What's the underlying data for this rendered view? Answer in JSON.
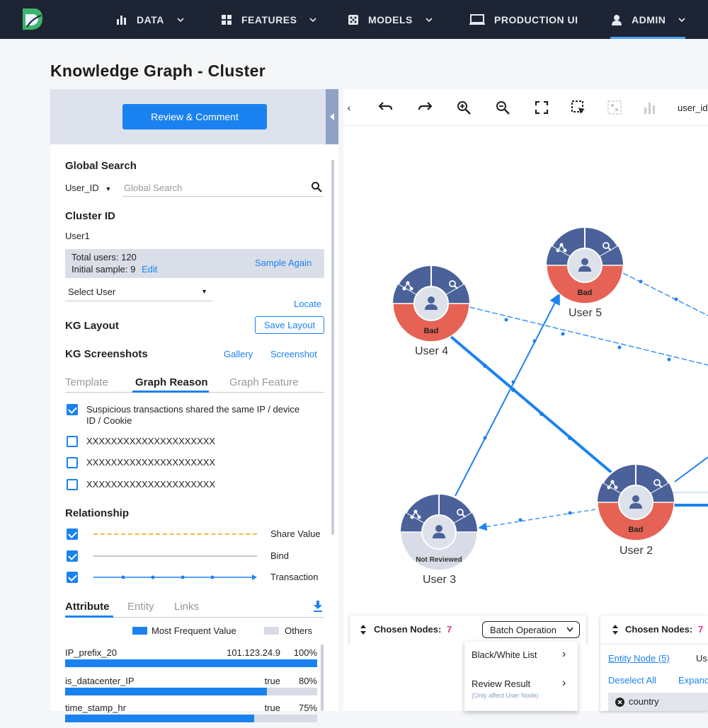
{
  "nav": {
    "items": [
      {
        "label": "DATA",
        "icon": "bar-chart-icon"
      },
      {
        "label": "FEATURES",
        "icon": "grid-icon"
      },
      {
        "label": "MODELS",
        "icon": "dice-icon"
      },
      {
        "label": "PRODUCTION UI",
        "icon": "monitor-icon"
      },
      {
        "label": "ADMIN",
        "icon": "user-icon"
      }
    ],
    "active": "ADMIN"
  },
  "page_title": "Knowledge Graph - Cluster",
  "left": {
    "review_button": "Review & Comment",
    "global_search": {
      "title": "Global Search",
      "field": "User_ID",
      "placeholder": "Global Search"
    },
    "cluster": {
      "title": "Cluster ID",
      "value": "User1",
      "total_users": "Total users: 120",
      "initial_sample": "Initial sample: 9",
      "edit": "Edit",
      "sample_again": "Sample Again"
    },
    "select_user": "Select User",
    "locate": "Locate",
    "kg_layout": "KG Layout",
    "save_layout": "Save Layout",
    "kg_screenshots": "KG Screenshots",
    "gallery": "Gallery",
    "screenshot": "Screenshot",
    "tabs": [
      "Template",
      "Graph Reason",
      "Graph Feature"
    ],
    "active_tab": "Graph Reason",
    "reasons": [
      {
        "text": "Suspicious transactions shared the same IP / device",
        "text2": "ID / Cookie",
        "checked": true
      },
      {
        "text": "XXXXXXXXXXXXXXXXXXXXX",
        "checked": false
      },
      {
        "text": "XXXXXXXXXXXXXXXXXXXXX",
        "checked": false
      },
      {
        "text": "XXXXXXXXXXXXXXXXXXXXX",
        "checked": false
      }
    ],
    "relationship_title": "Relationship",
    "relationships": [
      {
        "label": "Share Value",
        "style": "dashed",
        "color": "#f3b94a"
      },
      {
        "label": "Bind",
        "style": "solid",
        "color": "#c4c7cc"
      },
      {
        "label": "Transaction",
        "style": "arrow",
        "color": "#1a82f0"
      }
    ],
    "attr_tabs": [
      "Attribute",
      "Entity",
      "Links"
    ],
    "legend": {
      "most": "Most Frequent Value",
      "others": "Others",
      "most_color": "#1a82f0",
      "others_color": "#d6dbe6"
    },
    "attributes": [
      {
        "name": "IP_prefix_20",
        "value": "101.123.24.9",
        "pct": "100%",
        "frac": 1.0
      },
      {
        "name": "is_datacenter_IP",
        "value": "true",
        "pct": "80%",
        "frac": 0.8
      },
      {
        "name": "time_stamp_hr",
        "value": "true",
        "pct": "75%",
        "frac": 0.75
      }
    ]
  },
  "graph": {
    "toolbar_text": "user_id",
    "nodes": [
      {
        "label": "User 4",
        "status": "Bad"
      },
      {
        "label": "User 5",
        "status": "Bad"
      },
      {
        "label": "User 2",
        "status": "Bad"
      },
      {
        "label": "User 3",
        "status": "Not Reviewed"
      }
    ],
    "colors": {
      "node_top": "#4a6199",
      "bad": "#e56254",
      "not_reviewed": "#d8dce6",
      "edge": "#1a82f0"
    }
  },
  "panel1": {
    "title": "Chosen Nodes:",
    "count": "7",
    "batch": "Batch Operation",
    "menu": [
      {
        "label": "Black/White List"
      },
      {
        "label": "Review Result",
        "note": "(Only affect User Node)"
      }
    ]
  },
  "panel2": {
    "title": "Chosen Nodes:",
    "count": "7",
    "entity_link": "Entity Node (5)",
    "us": "Us",
    "deselect": "Deselect All",
    "expand": "Expand",
    "country": "country"
  }
}
